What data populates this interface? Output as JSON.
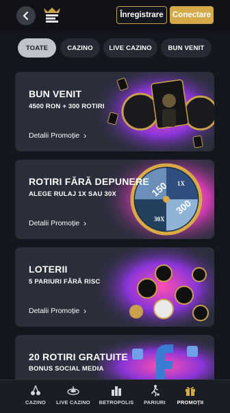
{
  "header": {
    "register_label": "Înregistrare",
    "login_label": "Conectare"
  },
  "filters": [
    "TOATE",
    "CAZINO",
    "LIVE CAZINO",
    "BUN VENIT"
  ],
  "promotions": [
    {
      "title": "BUN VENIT",
      "subtitle": "4500 RON + 300 ROTIRI",
      "details_label": "Detalii Promoție"
    },
    {
      "title": "ROTIRI FĂRĂ DEPUNERE",
      "subtitle": "ALEGE RULAJ 1X SAU 30X",
      "details_label": "Detalii Promoție",
      "wheel_labels": [
        "150",
        "300",
        "1X",
        "30X"
      ]
    },
    {
      "title": "LOTERII",
      "subtitle": "5 PARIURI FĂRĂ RISC",
      "details_label": "Detalii Promoție"
    },
    {
      "title": "20 ROTIRI GRATUITE",
      "subtitle": "BONUS SOCIAL MEDIA"
    }
  ],
  "tabs": [
    {
      "label": "CAZINO",
      "icon": "cherries-icon"
    },
    {
      "label": "LIVE CAZINO",
      "icon": "roulette-icon"
    },
    {
      "label": "BETROPOLIS",
      "icon": "city-icon"
    },
    {
      "label": "PARIURI",
      "icon": "soccer-player-icon"
    },
    {
      "label": "PROMOȚII",
      "icon": "gift-icon",
      "active": true
    }
  ],
  "colors": {
    "accent": "#d4a94a",
    "card": "#2a2e3b",
    "background": "#14161d"
  }
}
